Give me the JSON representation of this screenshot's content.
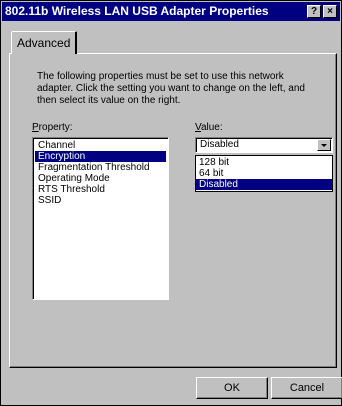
{
  "window": {
    "title": "802.11b Wireless LAN USB Adapter Properties",
    "help_label": "?",
    "close_label": "×"
  },
  "tabs": [
    {
      "label": "Advanced",
      "active": true
    }
  ],
  "description": "The following properties must be set to use this network adapter. Click the setting you want to change on the left, and then select its value on the right.",
  "property": {
    "label_accel": "P",
    "label_rest": "roperty:",
    "items": [
      {
        "label": "Channel",
        "selected": false
      },
      {
        "label": "Encryption",
        "selected": true
      },
      {
        "label": "Fragmentation Threshold",
        "selected": false
      },
      {
        "label": "Operating Mode",
        "selected": false
      },
      {
        "label": "RTS Threshold",
        "selected": false
      },
      {
        "label": "SSID",
        "selected": false
      }
    ]
  },
  "value": {
    "label_accel": "V",
    "label_rest": "alue:",
    "current": "Disabled",
    "options": [
      {
        "label": "128 bit",
        "selected": false
      },
      {
        "label": "64 bit",
        "selected": false
      },
      {
        "label": "Disabled",
        "selected": true
      }
    ]
  },
  "buttons": {
    "ok": "OK",
    "cancel": "Cancel"
  },
  "colors": {
    "face": "#c0c0c0",
    "titlebar": "#000080",
    "selection": "#000080"
  }
}
